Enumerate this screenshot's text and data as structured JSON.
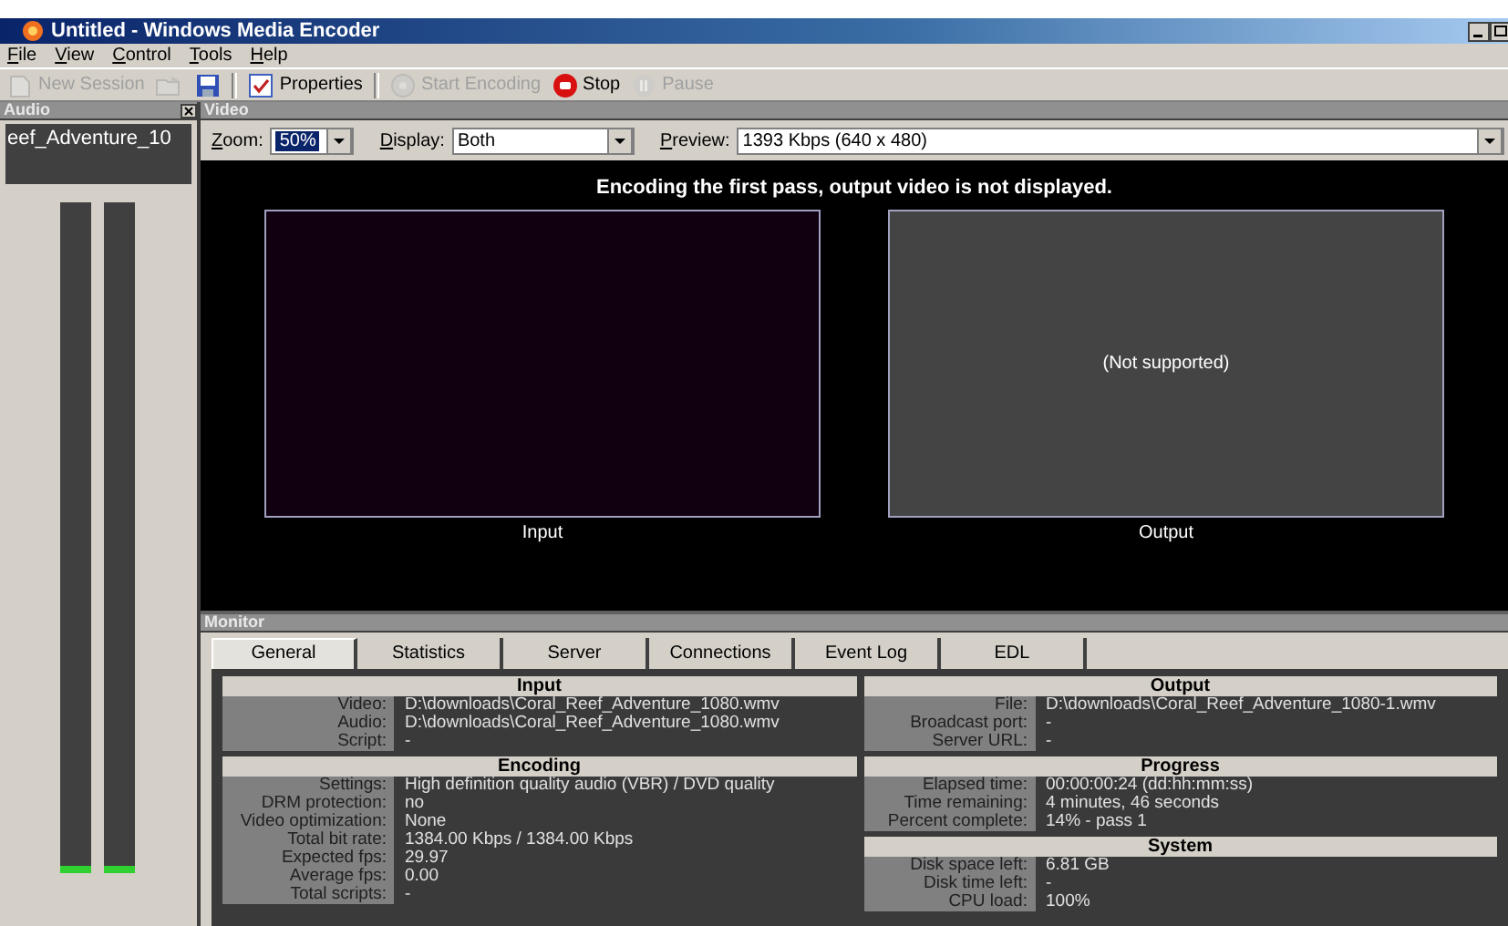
{
  "window": {
    "title": "Untitled - Windows Media Encoder"
  },
  "menu": [
    "File",
    "View",
    "Control",
    "Tools",
    "Help"
  ],
  "toolbar": [
    {
      "kind": "new-session",
      "label": "New Session",
      "disabled": true
    },
    {
      "kind": "open",
      "disabled": true
    },
    {
      "kind": "save",
      "disabled": false
    },
    {
      "kind": "separator"
    },
    {
      "kind": "properties",
      "label": "Properties",
      "disabled": false
    },
    {
      "kind": "separator"
    },
    {
      "kind": "start",
      "label": "Start Encoding",
      "disabled": true
    },
    {
      "kind": "stop",
      "label": "Stop",
      "disabled": false
    },
    {
      "kind": "pause",
      "label": "Pause",
      "disabled": true
    }
  ],
  "audio_panel": {
    "title": "Audio",
    "source": "eef_Adventure_10",
    "meters": [
      {
        "level": 0.01
      },
      {
        "level": 0.01
      }
    ]
  },
  "video_panel": {
    "title": "Video",
    "zoom": {
      "label": "Zoom:",
      "value": "50%"
    },
    "display": {
      "label": "Display:",
      "value": "Both"
    },
    "preview": {
      "label": "Preview:",
      "value": "1393 Kbps (640 x 480)"
    },
    "message": "Encoding the first pass, output video is not displayed.",
    "panes": [
      {
        "kind": "input",
        "label": "Input"
      },
      {
        "kind": "output",
        "label": "Output",
        "note": "(Not supported)"
      }
    ]
  },
  "monitor": {
    "title": "Monitor",
    "tabs": [
      {
        "label": "General",
        "selected": true
      },
      {
        "label": "Statistics",
        "selected": false
      },
      {
        "label": "Server",
        "selected": false
      },
      {
        "label": "Connections",
        "selected": false
      },
      {
        "label": "Event Log",
        "selected": false
      },
      {
        "label": "EDL",
        "selected": false
      }
    ],
    "columns": [
      [
        {
          "title": "Input",
          "rows": [
            {
              "label": "Video:",
              "value": "D:\\downloads\\Coral_Reef_Adventure_1080.wmv"
            },
            {
              "label": "Audio:",
              "value": "D:\\downloads\\Coral_Reef_Adventure_1080.wmv"
            },
            {
              "label": "Script:",
              "value": "-"
            }
          ]
        },
        {
          "title": "Encoding",
          "rows": [
            {
              "label": "Settings:",
              "value": "High definition quality audio (VBR)  / DVD quality"
            },
            {
              "label": "DRM protection:",
              "value": "no"
            },
            {
              "label": "Video optimization:",
              "value": "None"
            },
            {
              "label": "Total bit rate:",
              "value": "1384.00 Kbps / 1384.00 Kbps"
            },
            {
              "label": "Expected fps:",
              "value": "29.97"
            },
            {
              "label": "Average fps:",
              "value": "0.00"
            },
            {
              "label": "Total scripts:",
              "value": "-"
            }
          ]
        }
      ],
      [
        {
          "title": "Output",
          "rows": [
            {
              "label": "File:",
              "value": "D:\\downloads\\Coral_Reef_Adventure_1080-1.wmv"
            },
            {
              "label": "Broadcast port:",
              "value": "-"
            },
            {
              "label": "Server URL:",
              "value": "-"
            }
          ]
        },
        {
          "title": "Progress",
          "rows": [
            {
              "label": "Elapsed time:",
              "value": "00:00:00:24  (dd:hh:mm:ss)"
            },
            {
              "label": "Time remaining:",
              "value": "4 minutes, 46 seconds"
            },
            {
              "label": "Percent complete:",
              "value": "14% - pass 1"
            }
          ]
        },
        {
          "title": "System",
          "rows": [
            {
              "label": "Disk space left:",
              "value": "6.81 GB"
            },
            {
              "label": "Disk time left:",
              "value": "-"
            },
            {
              "label": "CPU load:",
              "value": "100%"
            }
          ]
        }
      ]
    ]
  }
}
